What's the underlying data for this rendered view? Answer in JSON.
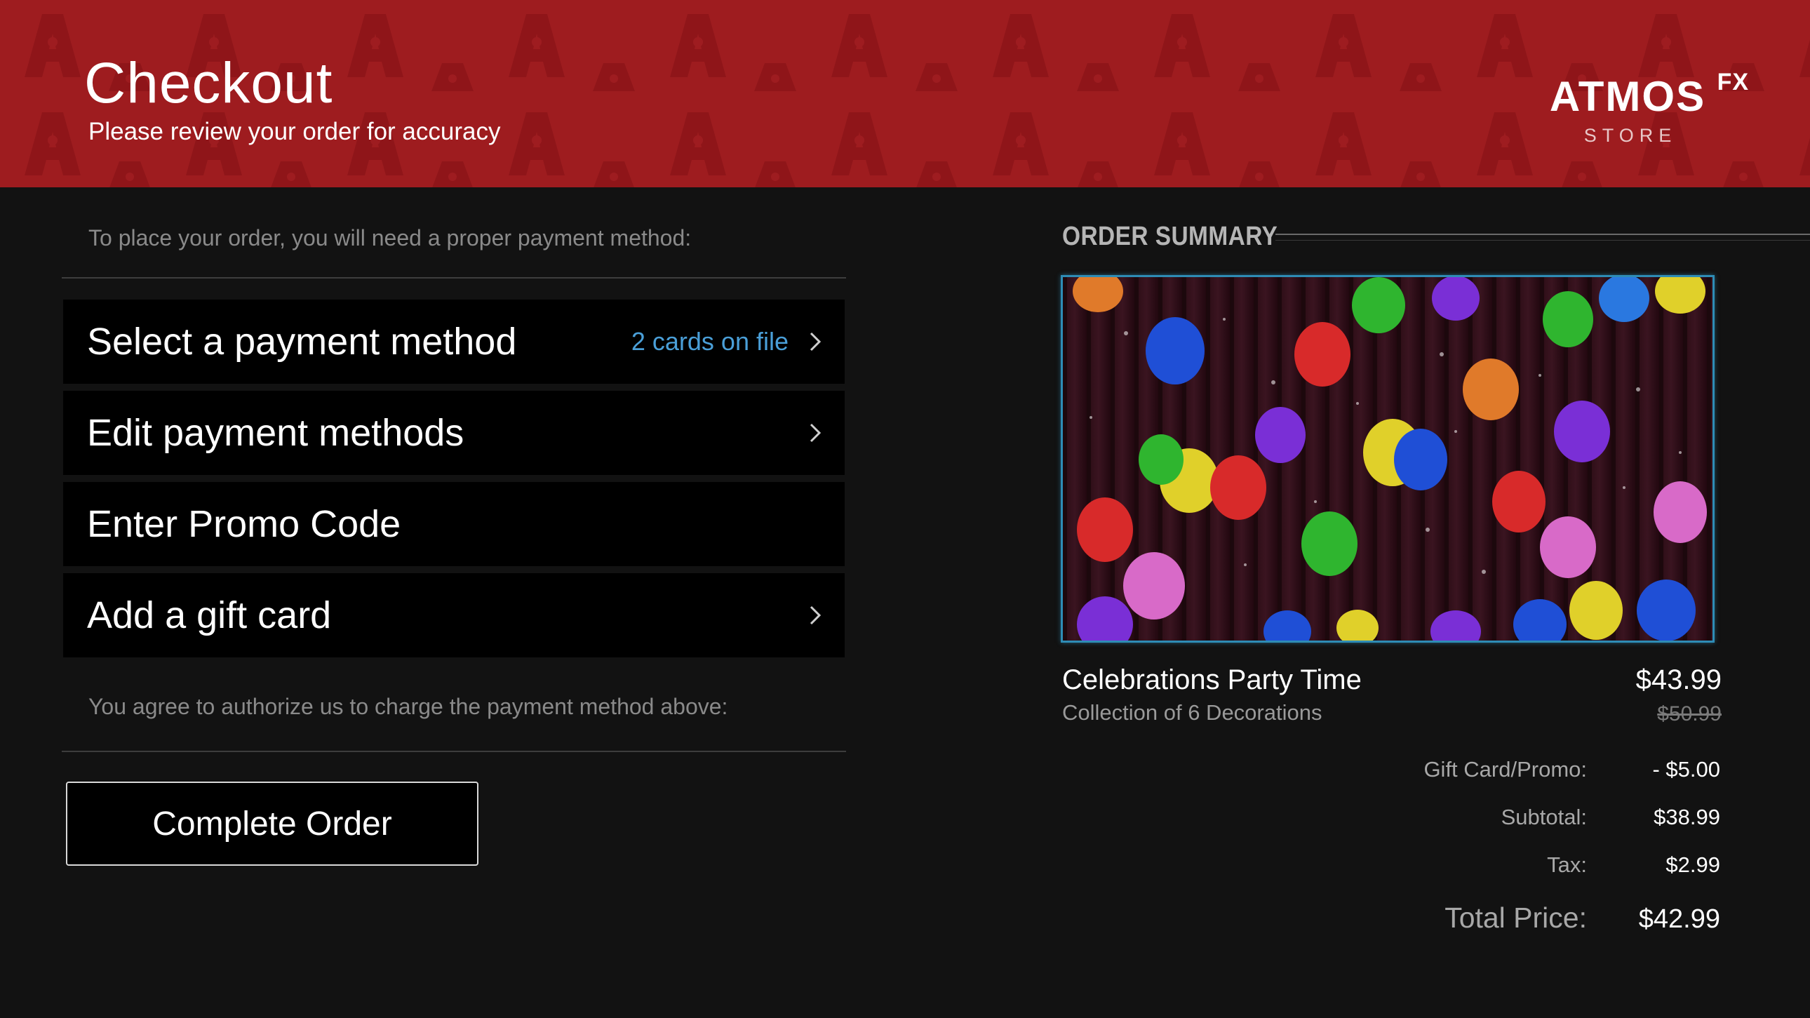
{
  "header": {
    "title": "Checkout",
    "subtitle": "Please review your order for accuracy",
    "brand_main": "ATMOS",
    "brand_sup": "FX",
    "brand_store": "STORE"
  },
  "payment": {
    "instruction": "To place your order, you will need a proper payment method:",
    "options": [
      {
        "label": "Select a payment method",
        "meta": "2 cards on file",
        "chevron": "chevron-right-icon"
      },
      {
        "label": "Edit payment methods",
        "meta": "",
        "chevron": "chevron-right-icon"
      },
      {
        "label": "Enter Promo Code",
        "meta": ""
      },
      {
        "label": "Add a gift card",
        "meta": "",
        "chevron": "chevron-right-icon"
      }
    ],
    "agreement": "You agree to authorize us to charge the payment method above:",
    "complete_label": "Complete Order"
  },
  "summary": {
    "heading": "ORDER SUMMARY",
    "product": {
      "name": "Celebrations Party Time",
      "description": "Collection of 6 Decorations",
      "price": "$43.99",
      "original_price": "$50.99"
    },
    "totals": [
      {
        "label": "Gift Card/Promo:",
        "value": "- $5.00"
      },
      {
        "label": "Subtotal:",
        "value": "$38.99"
      },
      {
        "label": "Tax:",
        "value": "$2.99"
      }
    ],
    "grand_total": {
      "label": "Total Price:",
      "value": "$42.99"
    }
  },
  "colors": {
    "header_bg": "#9e1c1f",
    "page_bg": "#121212",
    "option_bg": "#000000",
    "accent_link": "#4a9fd8",
    "image_border": "#2e8cb5"
  }
}
